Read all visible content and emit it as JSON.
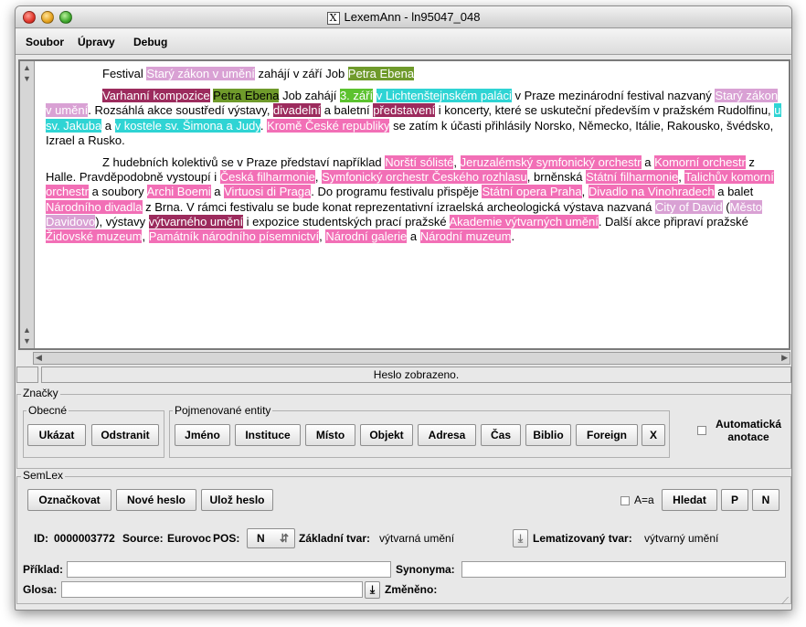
{
  "window": {
    "title": "LexemAnn - ln95047_048"
  },
  "menu": [
    "Soubor",
    "Úpravy",
    "Debug"
  ],
  "document": {
    "paragraphs": [
      [
        {
          "t": "Festival "
        },
        {
          "t": "Starý zákon v umění",
          "c": "#d9a1d4"
        },
        {
          "t": " zahájí v září Job "
        },
        {
          "t": "Petra Ebena",
          "c": "#6f9a2b"
        }
      ],
      [
        {
          "t": "Varhanní kompozice",
          "c": "#9c2b5d"
        },
        {
          "t": " "
        },
        {
          "t": "Petra Ebena",
          "c": "#6f9a2b",
          "fg": "#000"
        },
        {
          "t": " Job zahájí "
        },
        {
          "t": "3. září",
          "c": "#5cc22f"
        },
        {
          "t": " "
        },
        {
          "t": "v Lichtenštejnském paláci",
          "c": "#2fd4d4"
        },
        {
          "t": " v Praze mezinárodní festival nazvaný "
        },
        {
          "t": "Starý zákon v umění",
          "c": "#d9a1d4"
        },
        {
          "t": ". Rozsáhlá akce soustředí výstavy, "
        },
        {
          "t": "divadelní",
          "c": "#9c2b5d"
        },
        {
          "t": " a baletní "
        },
        {
          "t": "představení",
          "c": "#9c2b5d"
        },
        {
          "t": " i koncerty, které se uskuteční především v pražském Rudolfinu, "
        },
        {
          "t": "u sv. Jakuba",
          "c": "#2fd4d4"
        },
        {
          "t": " a "
        },
        {
          "t": "v kostele sv. Šimona a Judy",
          "c": "#2fd4d4"
        },
        {
          "t": ". "
        },
        {
          "t": "Kromě České republiky",
          "c": "#f26fb6"
        },
        {
          "t": " se zatím k účasti přihlásily Norsko, Německo, Itálie, Rakousko, švédsko, Izrael a Rusko."
        }
      ],
      [
        {
          "t": "Z hudebních kolektivů se v Praze představí například "
        },
        {
          "t": "Norští sólisté",
          "c": "#f26fb6"
        },
        {
          "t": ", "
        },
        {
          "t": "Jeruzalémský symfonický orchestr",
          "c": "#f26fb6"
        },
        {
          "t": " a "
        },
        {
          "t": "Komorní orchestr",
          "c": "#f26fb6"
        },
        {
          "t": " z Halle. Pravděpodobně vystoupí i "
        },
        {
          "t": "Česká filharmonie",
          "c": "#f26fb6"
        },
        {
          "t": ", "
        },
        {
          "t": "Symfonický orchestr Českého rozhlasu",
          "c": "#f26fb6"
        },
        {
          "t": ", brněnská "
        },
        {
          "t": "Státní filharmonie",
          "c": "#f26fb6"
        },
        {
          "t": ", "
        },
        {
          "t": "Talichův komorní orchestr",
          "c": "#f26fb6"
        },
        {
          "t": " a soubory "
        },
        {
          "t": "Archi Boemi",
          "c": "#f26fb6"
        },
        {
          "t": " a "
        },
        {
          "t": "Virtuosi di Praga",
          "c": "#f26fb6"
        },
        {
          "t": ". Do programu festivalu přispěje "
        },
        {
          "t": "Státní opera Praha",
          "c": "#f26fb6"
        },
        {
          "t": ", "
        },
        {
          "t": "Divadlo na Vinohradech",
          "c": "#f26fb6"
        },
        {
          "t": " a balet "
        },
        {
          "t": "Národního divadla",
          "c": "#f26fb6"
        },
        {
          "t": " z Brna. V rámci festivalu se bude konat reprezentativní izraelská archeologická výstava nazvaná "
        },
        {
          "t": "City of David",
          "c": "#d9a1d4"
        },
        {
          "t": " ("
        },
        {
          "t": "Město Davidovo",
          "c": "#d9a1d4"
        },
        {
          "t": "), výstavy "
        },
        {
          "t": "výtvarného umění",
          "c": "#9c2b5d"
        },
        {
          "t": " i expozice studentských prací pražské "
        },
        {
          "t": "Akademie výtvarných umění",
          "c": "#f26fb6"
        },
        {
          "t": ". Další akce připraví pražské "
        },
        {
          "t": "Židovské muzeum",
          "c": "#f26fb6"
        },
        {
          "t": ", "
        },
        {
          "t": "Památník národního písemnictví",
          "c": "#f26fb6"
        },
        {
          "t": ", "
        },
        {
          "t": "Národní galerie",
          "c": "#f26fb6"
        },
        {
          "t": " a "
        },
        {
          "t": "Národní muzeum",
          "c": "#f26fb6"
        },
        {
          "t": "."
        }
      ]
    ]
  },
  "status": "Heslo zobrazeno.",
  "znacky": {
    "title": "Značky",
    "obecne": {
      "title": "Obecné",
      "show": "Ukázat",
      "remove": "Odstranit"
    },
    "entity": {
      "title": "Pojmenované entity",
      "buttons": [
        "Jméno",
        "Instituce",
        "Místo",
        "Objekt",
        "Adresa",
        "Čas",
        "Biblio",
        "Foreign",
        "X"
      ]
    },
    "auto": "Automatická anotace"
  },
  "semlex": {
    "title": "SemLex",
    "mark": "Označkovat",
    "new": "Nové heslo",
    "save": "Ulož heslo",
    "case": "A=a",
    "search": "Hledat",
    "p": "P",
    "n": "N",
    "id_label": "ID:",
    "id": "0000003772",
    "source_label": "Source:",
    "source": "Eurovoc",
    "pos_label": "POS:",
    "pos": "N",
    "base_label": "Základní tvar:",
    "base": "výtvarná umění",
    "lemma_label": "Lematizovaný tvar:",
    "lemma": "výtvarný umění",
    "example_label": "Příklad:",
    "synonyms_label": "Synonyma:",
    "gloss_label": "Glosa:",
    "changed_label": "Změněno:"
  }
}
